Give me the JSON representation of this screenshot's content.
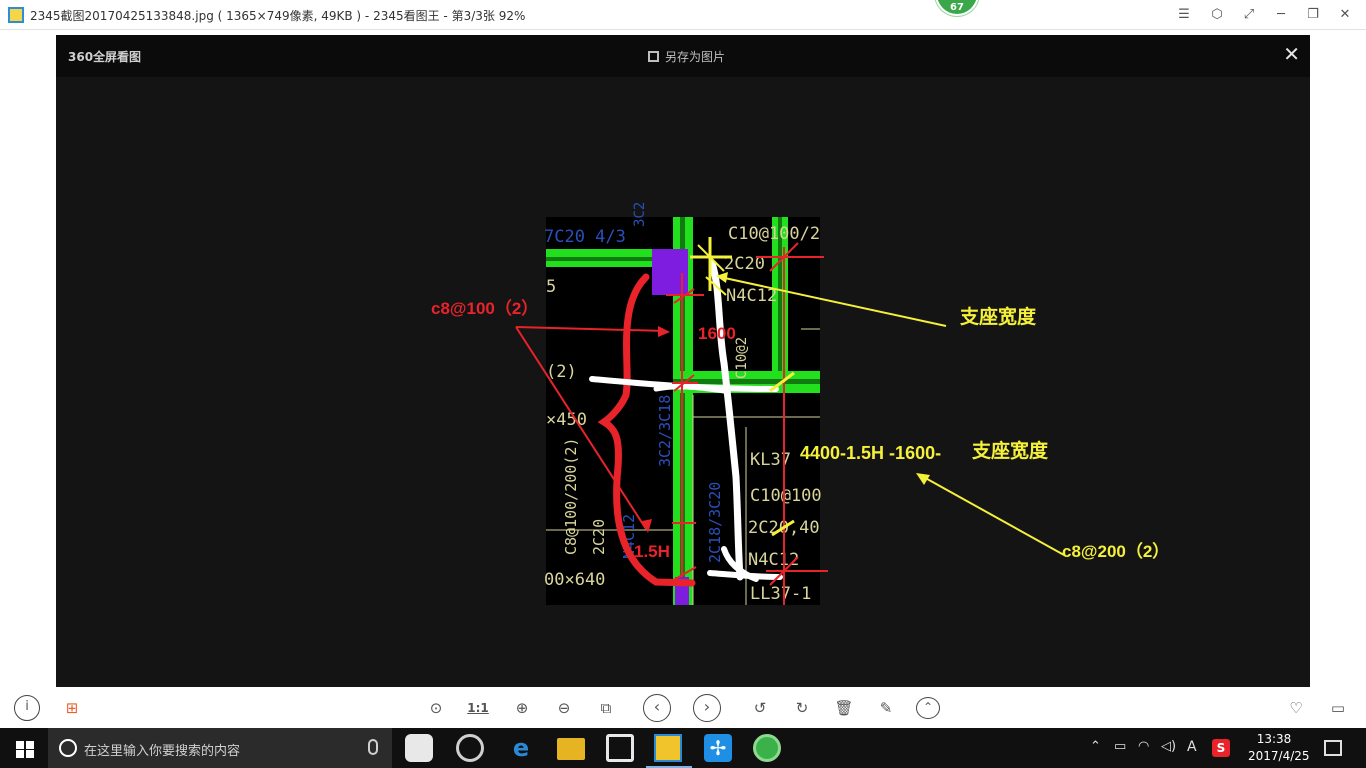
{
  "window": {
    "title": "2345截图20170425133848.jpg ( 1365×749像素, 49KB ) - 2345看图王 - 第3/3张 92%",
    "badge": "67"
  },
  "viewer": {
    "logo": "360全屏看图",
    "save_label": "另存为图片"
  },
  "drawing": {
    "cad_texts": [
      "7C20 4/3",
      "3C2",
      "C10@100/2",
      "2C20",
      "N4C12",
      "5",
      "(2)",
      "×450",
      "3C2/3C18",
      "C8@100/200(2)",
      "2C20",
      "N4C12",
      "2C18/3C20",
      "KL37",
      "C10@100",
      "2C20,40",
      "N4C12",
      "00×640",
      "LL37-1",
      "C10@2"
    ],
    "annotations": {
      "c8_100": "c8@100（2）",
      "dim_1600": "1600",
      "support_width": "支座宽度",
      "formula": "4400-1.5H -1600-",
      "formula_suffix": "支座宽度",
      "c8_200": "c8@200（2）",
      "h15": "1.5H"
    },
    "colors": {
      "red": "#e8232a",
      "yellow": "#f5f03a",
      "green": "#22e01e",
      "purple": "#7e1ce0",
      "white": "#ffffff",
      "cad_blue": "#2a4fb8",
      "cad_yellow": "#d8d49a"
    }
  },
  "toolbar": {
    "one_to_one": "1:1"
  },
  "taskbar": {
    "search_placeholder": "在这里输入你要搜索的内容",
    "ime_label": "A",
    "time": "13:38",
    "date": "2017/4/25"
  }
}
